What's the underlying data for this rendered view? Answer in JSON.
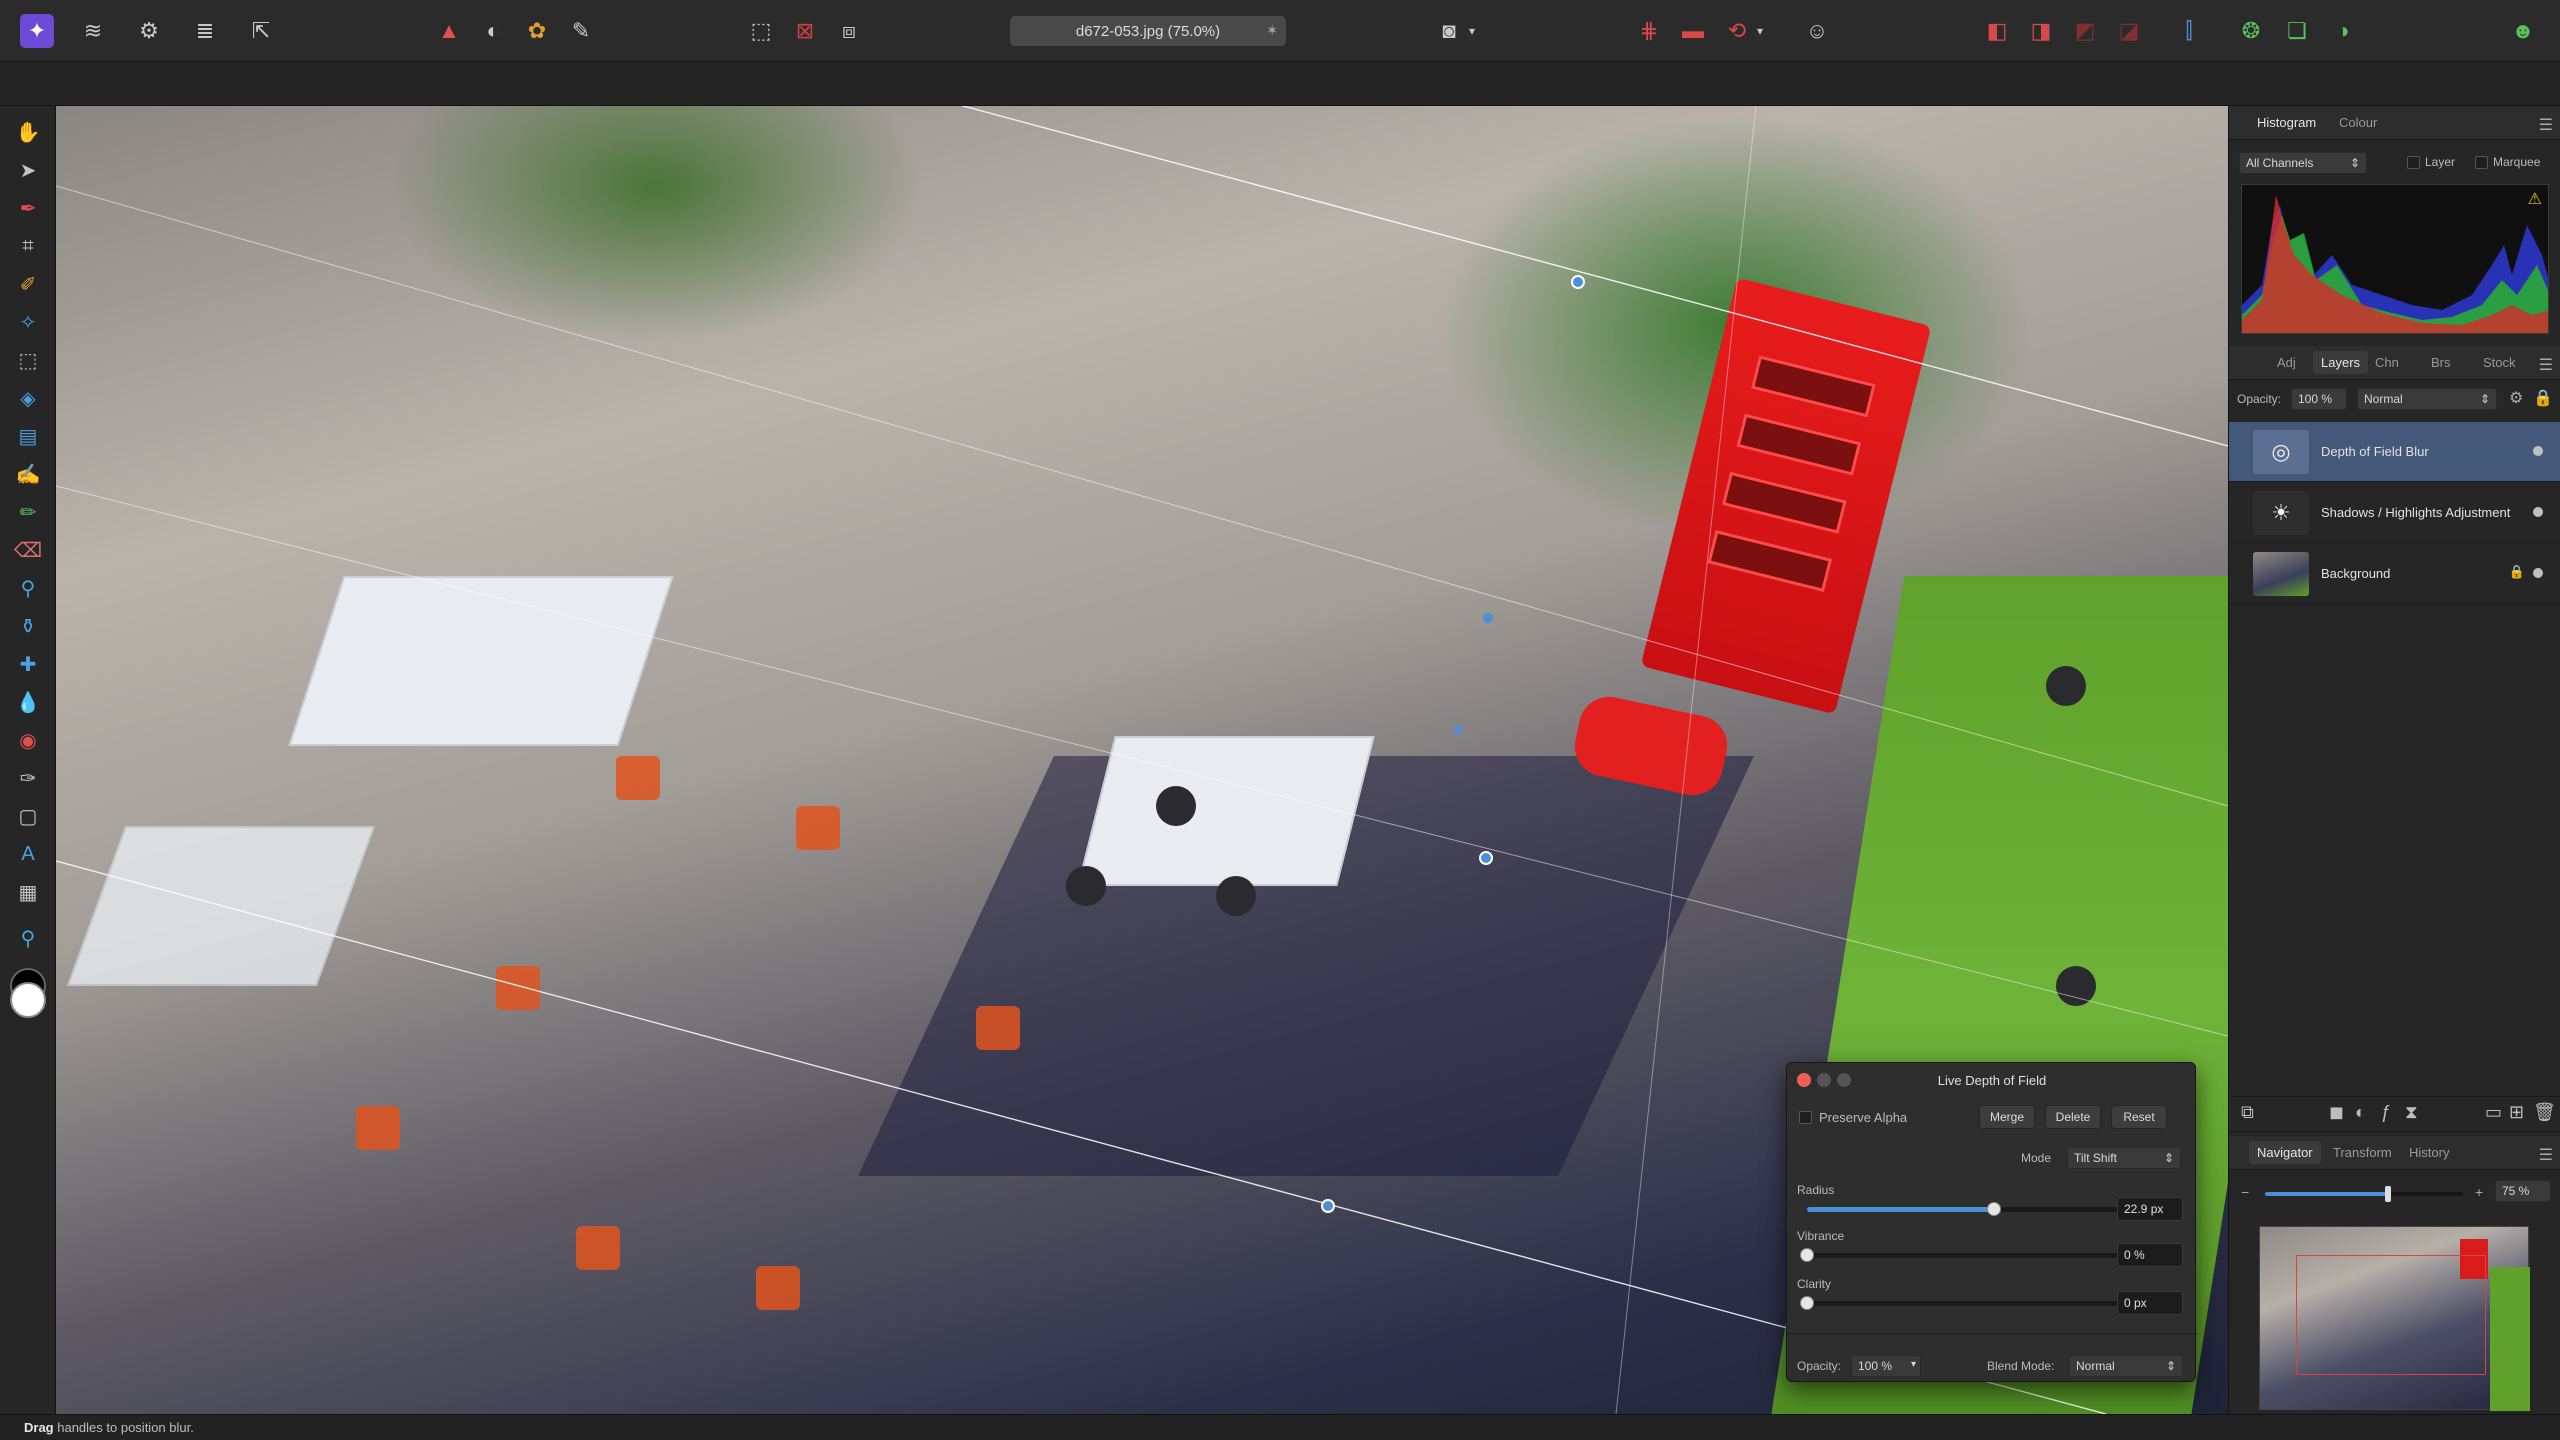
{
  "document": {
    "title": "d672-053.jpg (75.0%)",
    "close_glyph": "✶"
  },
  "toolbar": {
    "personas": [
      "photo-persona-icon",
      "liquify-persona-icon",
      "develop-persona-icon",
      "tone-mapping-persona-icon",
      "export-persona-icon"
    ],
    "center_icons": [
      "auto-levels-icon",
      "auto-contrast-icon",
      "auto-colour-icon",
      "auto-white-balance-icon"
    ],
    "selection_icons": [
      "select-all-icon",
      "deselect-icon",
      "invert-selection-icon"
    ],
    "right_icons": [
      "quick-mask-icon",
      "snapping-icon",
      "assistant-icon",
      "arrange-icon",
      "align-icon",
      "boolean-add-icon",
      "boolean-subtract-icon",
      "boolean-intersect-icon",
      "boolean-xor-icon",
      "user-icon"
    ]
  },
  "tools": [
    "view-tool-icon",
    "move-tool-icon",
    "colour-picker-icon",
    "crop-tool-icon",
    "selection-brush-icon",
    "flood-select-icon",
    "marquee-tool-icon",
    "flood-fill-icon",
    "gradient-tool-icon",
    "paint-brush-icon",
    "pixel-brush-icon",
    "erase-brush-icon",
    "dodge-icon",
    "clone-tool-icon",
    "healing-icon",
    "blur-brush-icon",
    "red-eye-icon",
    "pen-tool-icon",
    "rectangle-tool-icon",
    "text-tool-icon",
    "mesh-warp-icon",
    "zoom-tool-icon"
  ],
  "histogram_panel": {
    "tabs": [
      "Histogram",
      "Colour"
    ],
    "channel": "All Channels",
    "layer_label": "Layer",
    "marquee_label": "Marquee",
    "warning_glyph": "⚠"
  },
  "layers_panel": {
    "tabs": [
      "Adj",
      "Layers",
      "Chn",
      "Brs",
      "Stock"
    ],
    "opacity_label": "Opacity:",
    "opacity_value": "100 %",
    "blend_mode": "Normal",
    "layers": [
      {
        "name": "Depth of Field Blur",
        "selected": true,
        "icon": "depth-of-field-icon"
      },
      {
        "name": "Shadows / Highlights Adjustment",
        "selected": false,
        "icon": "shadows-highlights-icon"
      },
      {
        "name": "Background",
        "selected": false,
        "icon": "image-thumbnail",
        "locked": true
      }
    ]
  },
  "navigator_panel": {
    "tabs": [
      "Navigator",
      "Transform",
      "History"
    ],
    "zoom_value": "75 %",
    "zoom_level": 0.62
  },
  "dof_dialog": {
    "title": "Live Depth of Field",
    "preserve_alpha_label": "Preserve Alpha",
    "merge_label": "Merge",
    "delete_label": "Delete",
    "reset_label": "Reset",
    "mode_label": "Mode",
    "mode_value": "Tilt Shift",
    "radius": {
      "label": "Radius",
      "value": "22.9 px",
      "level": 0.6
    },
    "vibrance": {
      "label": "Vibrance",
      "value": "0 %",
      "level": 0
    },
    "clarity": {
      "label": "Clarity",
      "value": "0 px",
      "level": 0
    },
    "opacity_label": "Opacity:",
    "opacity_value": "100 %",
    "blend_mode_label": "Blend Mode:",
    "blend_mode_value": "Normal"
  },
  "status": {
    "bold": "Drag",
    "text": " handles to position blur."
  },
  "colors": {
    "accent": "#4a90d9",
    "selected_layer": "#44597a",
    "phone_booth": "#e01b1b",
    "grass": "#63a82e"
  }
}
